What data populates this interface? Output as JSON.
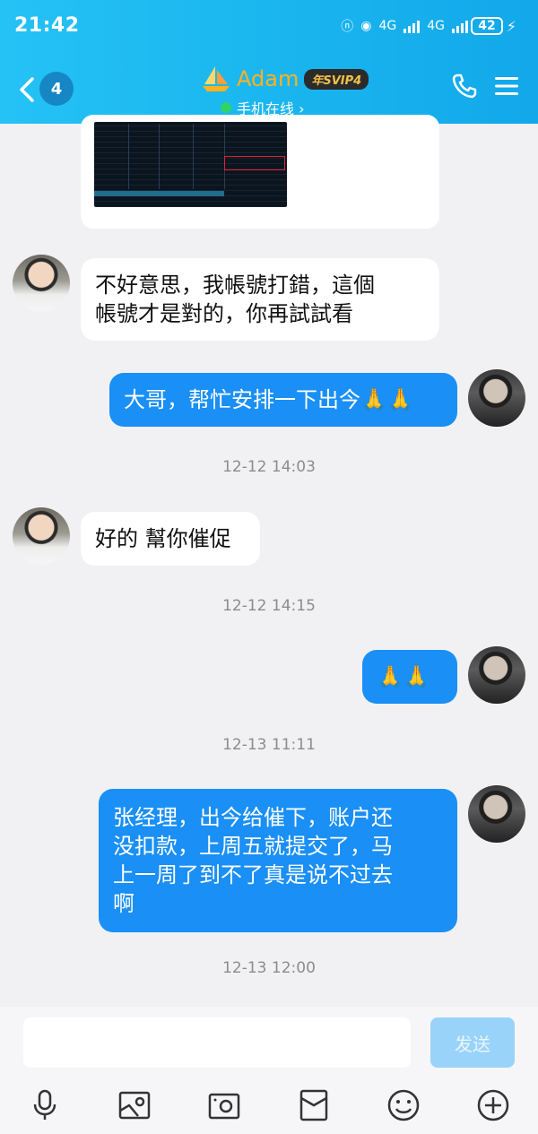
{
  "status_bar": {
    "time": "21:42",
    "network1": "4G",
    "network2": "4G",
    "battery": "42"
  },
  "header": {
    "unread_count": "4",
    "title": "Adam",
    "vip_badge": "年SVIP4",
    "subtitle": "手机在线 ›",
    "icons": [
      "back-icon",
      "phone-icon",
      "menu-icon"
    ],
    "brand_color": "#1ab6ef"
  },
  "messages": [
    {
      "dir": "in",
      "type": "image"
    },
    {
      "dir": "in",
      "text": "不好意思，我帳號打錯，這個帳號才是對的，你再試試看",
      "line1": "不好意思，我帳號打錯，這個",
      "line2": "帳號才是對的，你再試試看"
    },
    {
      "dir": "out",
      "text": "大哥，帮忙安排一下出今🙏🙏"
    },
    {
      "timestamp": "12-12 14:03"
    },
    {
      "dir": "in",
      "text": "好的 幫你催促"
    },
    {
      "timestamp": "12-12 14:15"
    },
    {
      "dir": "out",
      "text": "🙏🙏"
    },
    {
      "timestamp": "12-13 11:11"
    },
    {
      "dir": "out",
      "line1": "张经理，出今给催下，账户还",
      "line2": "没扣款，上周五就提交了，马",
      "line3": "上一周了到不了真是说不过去",
      "line4": "啊"
    },
    {
      "timestamp": "12-13 12:00"
    }
  ],
  "input": {
    "placeholder": "",
    "send_label": "发送"
  },
  "toolbar": {
    "icons": [
      "mic-icon",
      "image-icon",
      "camera-icon",
      "red-packet-icon",
      "emoji-icon",
      "plus-icon"
    ]
  }
}
